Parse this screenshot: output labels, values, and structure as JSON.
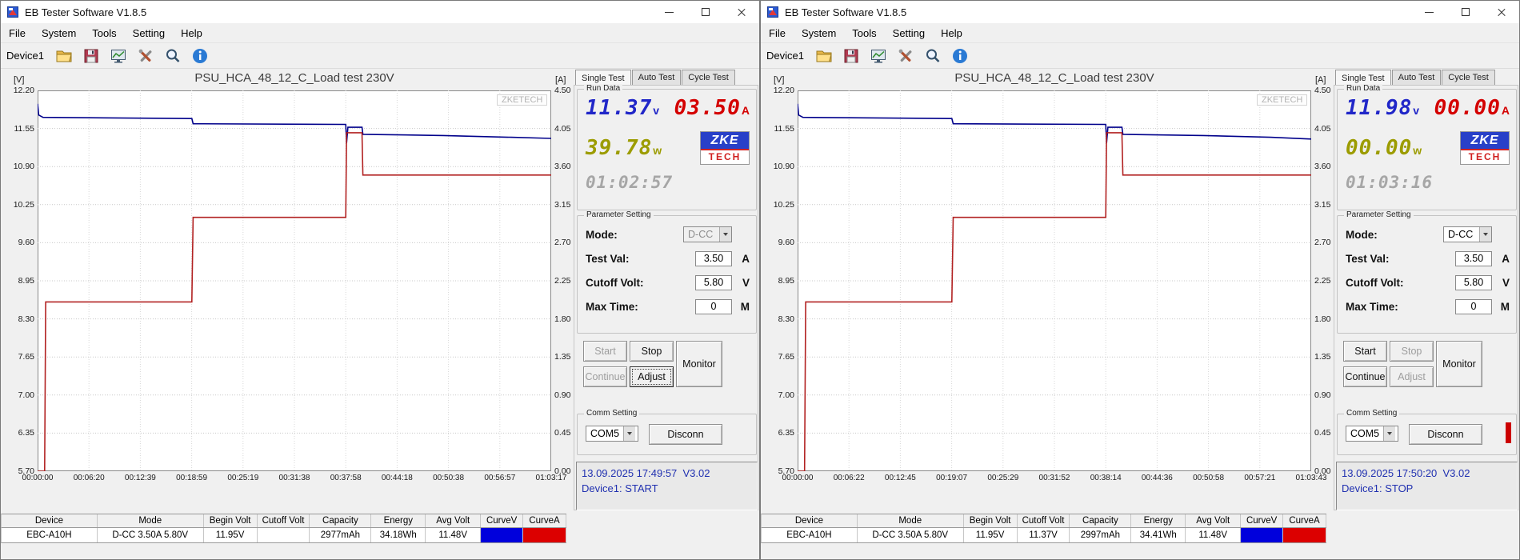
{
  "windows": [
    {
      "title": "EB Tester Software V1.8.5",
      "menu": [
        "File",
        "System",
        "Tools",
        "Setting",
        "Help"
      ],
      "toolbar": {
        "device_label": "Device1",
        "icons": [
          "open-file",
          "save",
          "graph-view",
          "tools",
          "zoom",
          "about"
        ]
      },
      "chart": {
        "title": "PSU_HCA_48_12_C_Load test 230V",
        "watermark": "ZKETECH",
        "left_axis_label": "[V]",
        "right_axis_label": "[A]"
      },
      "tabs": [
        "Single Test",
        "Auto Test",
        "Cycle Test"
      ],
      "run_data": {
        "label": "Run Data",
        "volt": "11.37",
        "volt_unit": "v",
        "amp": "03.50",
        "amp_unit": "A",
        "watt": "39.78",
        "watt_unit": "w",
        "time": "01:02:57",
        "logo_top": "ZKE",
        "logo_bottom": "TECH"
      },
      "param": {
        "label": "Parameter Setting",
        "mode_label": "Mode:",
        "mode_value": "D-CC",
        "mode_enabled": false,
        "test_val_label": "Test Val:",
        "test_val": "3.50",
        "test_val_unit": "A",
        "cutoff_label": "Cutoff Volt:",
        "cutoff": "5.80",
        "cutoff_unit": "V",
        "max_time_label": "Max Time:",
        "max_time": "0",
        "max_time_unit": "M"
      },
      "buttons": {
        "start": {
          "label": "Start",
          "enabled": false
        },
        "stop": {
          "label": "Stop",
          "enabled": true
        },
        "continue": {
          "label": "Continue",
          "enabled": false
        },
        "adjust": {
          "label": "Adjust",
          "enabled": true,
          "focused": true
        },
        "monitor": {
          "label": "Monitor",
          "enabled": true
        }
      },
      "comm": {
        "label": "Comm Setting",
        "port": "COM5",
        "disconn_label": "Disconn",
        "indicator": false
      },
      "status": {
        "line1": "13.09.2025 17:49:57  V3.02",
        "line2": "Device1: START"
      },
      "table": {
        "headers": [
          "Device",
          "Mode",
          "Begin Volt",
          "Cutoff Volt",
          "Capacity",
          "Energy",
          "Avg Volt",
          "CurveV",
          "CurveA"
        ],
        "row": [
          "EBC-A10H",
          "D-CC 3.50A 5.80V",
          "11.95V",
          "",
          "2977mAh",
          "34.18Wh",
          "11.48V"
        ],
        "curve_v_color": "#0000dc",
        "curve_a_color": "#dc0000"
      }
    },
    {
      "title": "EB Tester Software V1.8.5",
      "menu": [
        "File",
        "System",
        "Tools",
        "Setting",
        "Help"
      ],
      "toolbar": {
        "device_label": "Device1",
        "icons": [
          "open-file",
          "save",
          "graph-view",
          "tools",
          "zoom",
          "about"
        ]
      },
      "chart": {
        "title": "PSU_HCA_48_12_C_Load test 230V",
        "watermark": "ZKETECH",
        "left_axis_label": "[V]",
        "right_axis_label": "[A]"
      },
      "tabs": [
        "Single Test",
        "Auto Test",
        "Cycle Test"
      ],
      "run_data": {
        "label": "Run Data",
        "volt": "11.98",
        "volt_unit": "v",
        "amp": "00.00",
        "amp_unit": "A",
        "watt": "00.00",
        "watt_unit": "w",
        "time": "01:03:16",
        "logo_top": "ZKE",
        "logo_bottom": "TECH"
      },
      "param": {
        "label": "Parameter Setting",
        "mode_label": "Mode:",
        "mode_value": "D-CC",
        "mode_enabled": true,
        "test_val_label": "Test Val:",
        "test_val": "3.50",
        "test_val_unit": "A",
        "cutoff_label": "Cutoff Volt:",
        "cutoff": "5.80",
        "cutoff_unit": "V",
        "max_time_label": "Max Time:",
        "max_time": "0",
        "max_time_unit": "M"
      },
      "buttons": {
        "start": {
          "label": "Start",
          "enabled": true
        },
        "stop": {
          "label": "Stop",
          "enabled": false
        },
        "continue": {
          "label": "Continue",
          "enabled": true
        },
        "adjust": {
          "label": "Adjust",
          "enabled": false
        },
        "monitor": {
          "label": "Monitor",
          "enabled": true
        }
      },
      "comm": {
        "label": "Comm Setting",
        "port": "COM5",
        "disconn_label": "Disconn",
        "indicator": true
      },
      "status": {
        "line1": "13.09.2025 17:50:20  V3.02",
        "line2": "Device1: STOP"
      },
      "table": {
        "headers": [
          "Device",
          "Mode",
          "Begin Volt",
          "Cutoff Volt",
          "Capacity",
          "Energy",
          "Avg Volt",
          "CurveV",
          "CurveA"
        ],
        "row": [
          "EBC-A10H",
          "D-CC 3.50A 5.80V",
          "11.95V",
          "11.37V",
          "2997mAh",
          "34.41Wh",
          "11.48V"
        ],
        "curve_v_color": "#0000dc",
        "curve_a_color": "#dc0000"
      }
    }
  ],
  "chart_data": [
    {
      "type": "line",
      "title": "PSU_HCA_48_12_C_Load test 230V",
      "grid": "dotted",
      "x_seconds_max": 3797,
      "x_ticks": [
        "00:00:00",
        "00:06:20",
        "00:12:39",
        "00:18:59",
        "00:25:19",
        "00:31:38",
        "00:37:58",
        "00:44:18",
        "00:50:38",
        "00:56:57",
        "01:03:17"
      ],
      "left_axis": {
        "label": "[V]",
        "min": 5.7,
        "max": 12.2,
        "ticks": [
          "12.20",
          "11.55",
          "10.90",
          "10.25",
          "9.60",
          "8.95",
          "8.30",
          "7.65",
          "7.00",
          "6.35",
          "5.70"
        ]
      },
      "right_axis": {
        "label": "[A]",
        "min": 0.0,
        "max": 4.5,
        "ticks": [
          "4.50",
          "4.05",
          "3.60",
          "3.15",
          "2.70",
          "2.25",
          "1.80",
          "1.35",
          "0.90",
          "0.45",
          "0.00"
        ]
      },
      "series": [
        {
          "name": "Voltage (CurveV)",
          "axis": "left",
          "color": "#00008b",
          "points": [
            [
              0,
              11.97
            ],
            [
              8,
              11.78
            ],
            [
              40,
              11.74
            ],
            [
              1140,
              11.72
            ],
            [
              1150,
              11.63
            ],
            [
              2278,
              11.62
            ],
            [
              2284,
              11.3
            ],
            [
              2294,
              11.57
            ],
            [
              2398,
              11.57
            ],
            [
              2405,
              11.45
            ],
            [
              3000,
              11.43
            ],
            [
              3500,
              11.4
            ],
            [
              3797,
              11.38
            ]
          ]
        },
        {
          "name": "Current (CurveA)",
          "axis": "right",
          "color": "#b22222",
          "points": [
            [
              0,
              0.0
            ],
            [
              52,
              0.0
            ],
            [
              60,
              2.0
            ],
            [
              1140,
              2.0
            ],
            [
              1150,
              3.0
            ],
            [
              2278,
              3.0
            ],
            [
              2284,
              4.0
            ],
            [
              2398,
              4.0
            ],
            [
              2405,
              3.5
            ],
            [
              3797,
              3.5
            ]
          ]
        }
      ]
    },
    {
      "type": "line",
      "title": "PSU_HCA_48_12_C_Load test 230V",
      "grid": "dotted",
      "x_seconds_max": 3823,
      "x_ticks": [
        "00:00:00",
        "00:06:22",
        "00:12:45",
        "00:19:07",
        "00:25:29",
        "00:31:52",
        "00:38:14",
        "00:44:36",
        "00:50:58",
        "00:57:21",
        "01:03:43"
      ],
      "left_axis": {
        "label": "[V]",
        "min": 5.7,
        "max": 12.2,
        "ticks": [
          "12.20",
          "11.55",
          "10.90",
          "10.25",
          "9.60",
          "8.95",
          "8.30",
          "7.65",
          "7.00",
          "6.35",
          "5.70"
        ]
      },
      "right_axis": {
        "label": "[A]",
        "min": 0.0,
        "max": 4.5,
        "ticks": [
          "4.50",
          "4.05",
          "3.60",
          "3.15",
          "2.70",
          "2.25",
          "1.80",
          "1.35",
          "0.90",
          "0.45",
          "0.00"
        ]
      },
      "series": [
        {
          "name": "Voltage (CurveV)",
          "axis": "left",
          "color": "#00008b",
          "points": [
            [
              0,
              11.97
            ],
            [
              8,
              11.78
            ],
            [
              40,
              11.74
            ],
            [
              1148,
              11.72
            ],
            [
              1158,
              11.63
            ],
            [
              2294,
              11.62
            ],
            [
              2300,
              11.3
            ],
            [
              2310,
              11.57
            ],
            [
              2414,
              11.57
            ],
            [
              2421,
              11.45
            ],
            [
              3020,
              11.43
            ],
            [
              3520,
              11.4
            ],
            [
              3823,
              11.37
            ]
          ]
        },
        {
          "name": "Current (CurveA)",
          "axis": "right",
          "color": "#b22222",
          "points": [
            [
              0,
              0.0
            ],
            [
              52,
              0.0
            ],
            [
              60,
              2.0
            ],
            [
              1148,
              2.0
            ],
            [
              1158,
              3.0
            ],
            [
              2294,
              3.0
            ],
            [
              2300,
              4.0
            ],
            [
              2414,
              4.0
            ],
            [
              2421,
              3.5
            ],
            [
              3823,
              3.5
            ]
          ]
        }
      ]
    }
  ]
}
